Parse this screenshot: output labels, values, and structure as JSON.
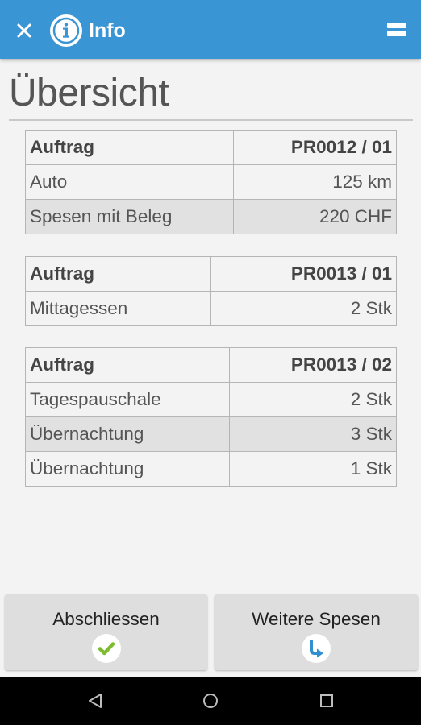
{
  "appbar": {
    "title": "Info",
    "close_icon": "close-icon",
    "info_icon": "info-icon",
    "menu_icon": "menu-icon",
    "color": "#3a95d4"
  },
  "page": {
    "title": "Übersicht"
  },
  "orders": [
    {
      "label": "Auftrag",
      "number": "PR0012 / 01",
      "items": [
        {
          "name": "Auto",
          "value": "125 km",
          "highlighted": false
        },
        {
          "name": "Spesen mit Beleg",
          "value": "220 CHF",
          "highlighted": true
        }
      ]
    },
    {
      "label": "Auftrag",
      "number": "PR0013 / 01",
      "items": [
        {
          "name": "Mittagessen",
          "value": "2 Stk",
          "highlighted": false
        }
      ]
    },
    {
      "label": "Auftrag",
      "number": "PR0013 / 02",
      "items": [
        {
          "name": "Tagespauschale",
          "value": "2 Stk",
          "highlighted": false
        },
        {
          "name": "Übernachtung",
          "value": "3 Stk",
          "highlighted": true
        },
        {
          "name": "Übernachtung",
          "value": "1 Stk",
          "highlighted": false
        }
      ]
    }
  ],
  "buttons": {
    "finish": {
      "label": "Abschliessen",
      "icon": "check-icon",
      "icon_color": "#7dbb2f"
    },
    "more": {
      "label": "Weitere Spesen",
      "icon": "arrow-turn-icon",
      "icon_color": "#2f8fd0"
    }
  },
  "navbar": {
    "back_icon": "back-icon",
    "home_icon": "home-icon",
    "recents_icon": "recents-icon"
  }
}
